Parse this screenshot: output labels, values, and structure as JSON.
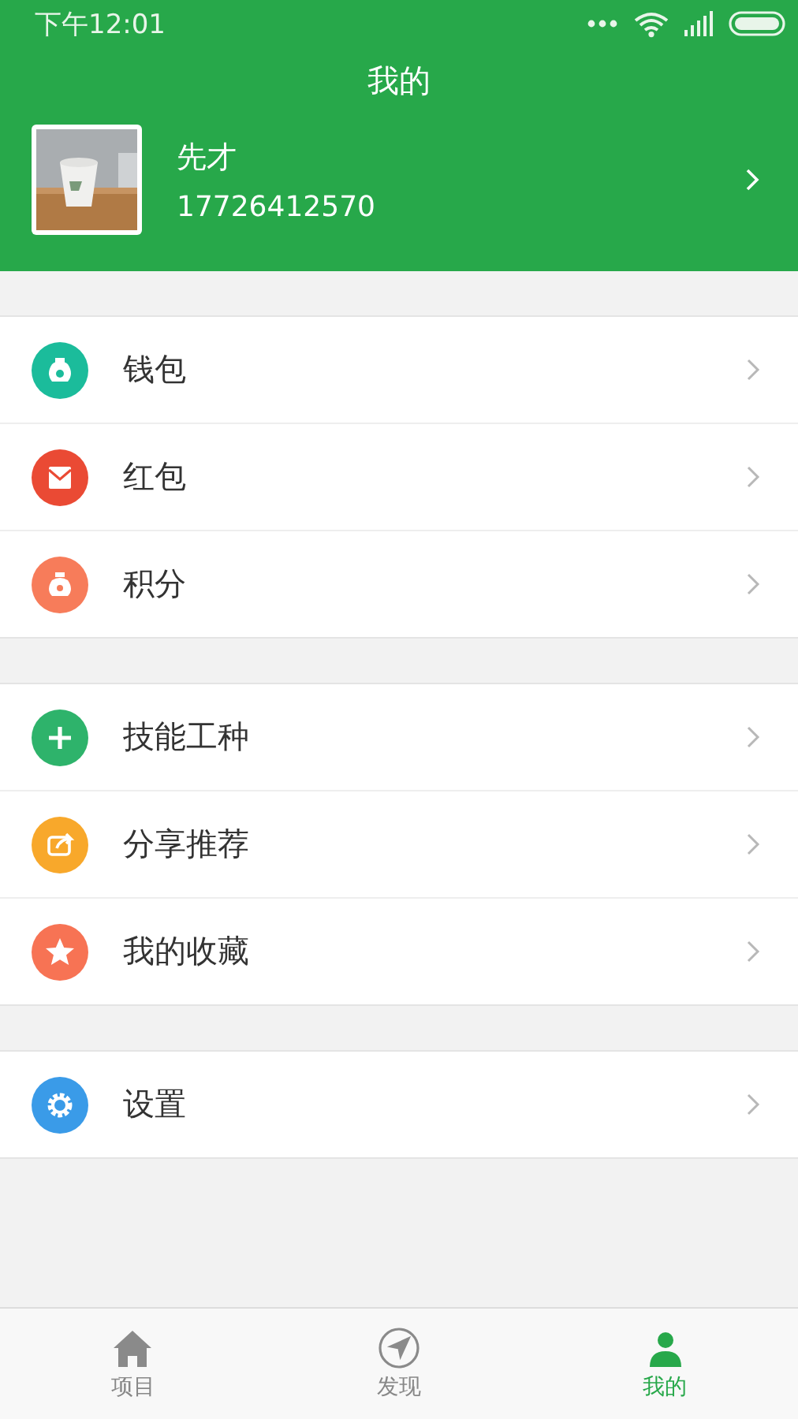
{
  "status_bar": {
    "time": "下午12:01"
  },
  "header": {
    "title": "我的"
  },
  "profile": {
    "name": "先才",
    "phone": "17726412570"
  },
  "groups": [
    {
      "items": [
        {
          "label": "钱包",
          "color": "#1bbc9b"
        },
        {
          "label": "红包",
          "color": "#ea4a34"
        },
        {
          "label": "积分",
          "color": "#f77c5a"
        }
      ]
    },
    {
      "items": [
        {
          "label": "技能工种",
          "color": "#2eb36b"
        },
        {
          "label": "分享推荐",
          "color": "#f8a82b"
        },
        {
          "label": "我的收藏",
          "color": "#f77354"
        }
      ]
    },
    {
      "items": [
        {
          "label": "设置",
          "color": "#3a9be8"
        }
      ]
    }
  ],
  "tabbar": [
    {
      "label": "项目",
      "selected": false
    },
    {
      "label": "发现",
      "selected": false
    },
    {
      "label": "我的",
      "selected": true
    }
  ]
}
